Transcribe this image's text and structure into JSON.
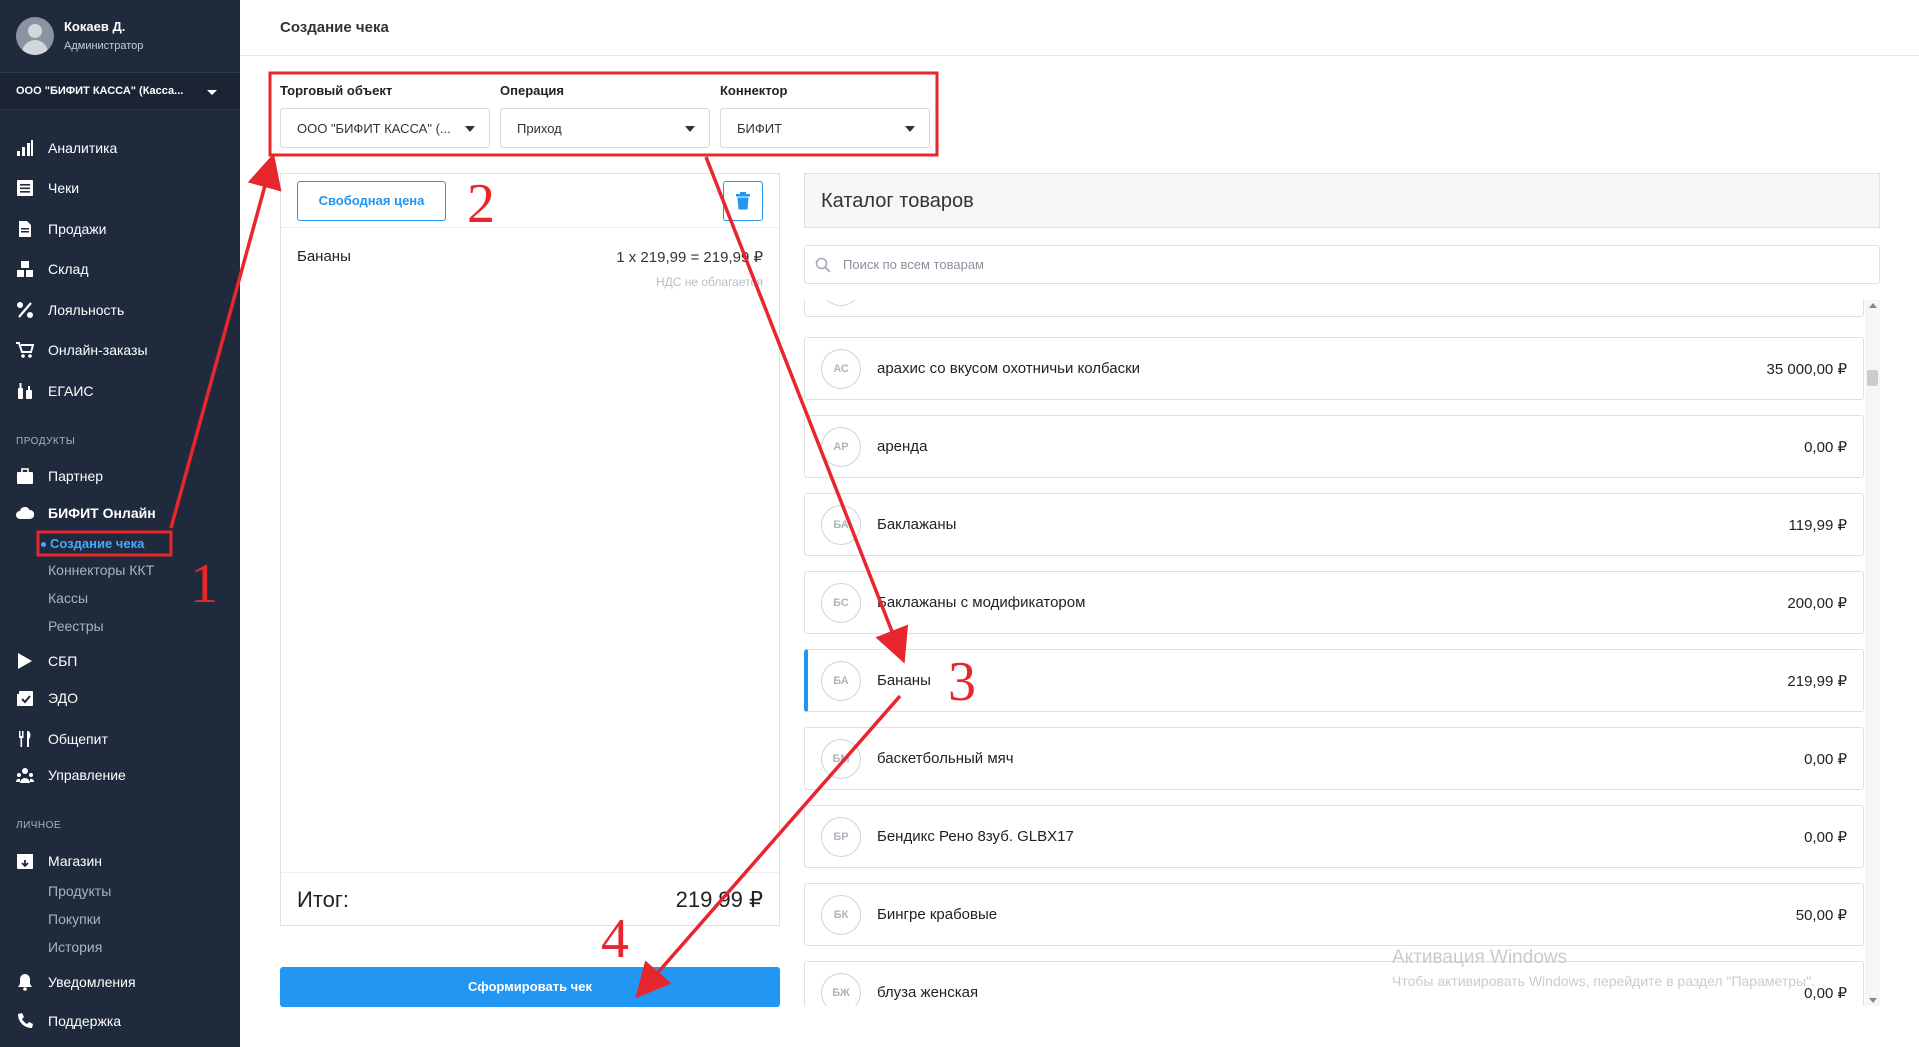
{
  "user": {
    "name": "Кокаев Д.",
    "role": "Администратор"
  },
  "org": {
    "label": "ООО \"БИФИТ КАССА\" (Касса..."
  },
  "nav": {
    "analytics": "Аналитика",
    "receipts": "Чеки",
    "sales": "Продажи",
    "warehouse": "Склад",
    "loyalty": "Лояльность",
    "online_orders": "Онлайн-заказы",
    "egais": "ЕГАИС",
    "products_section": "ПРОДУКТЫ",
    "partner": "Партнер",
    "bifit_online": "БИФИТ Онлайн",
    "create_receipt": "Создание чека",
    "kkt_connectors": "Коннекторы ККТ",
    "cash_registers": "Кассы",
    "registries": "Реестры",
    "sbp": "СБП",
    "edo": "ЭДО",
    "catering": "Общепит",
    "management": "Управление",
    "personal_section": "ЛИЧНОЕ",
    "shop": "Магазин",
    "shop_products": "Продукты",
    "purchases": "Покупки",
    "history": "История",
    "notifications": "Уведомления",
    "support": "Поддержка"
  },
  "page": {
    "title": "Создание чека"
  },
  "filters": {
    "trade_object_label": "Торговый объект",
    "trade_object_value": "ООО \"БИФИТ КАССА\" (...",
    "operation_label": "Операция",
    "operation_value": "Приход",
    "connector_label": "Коннектор",
    "connector_value": "БИФИТ"
  },
  "cart": {
    "free_price_label": "Свободная цена",
    "items": [
      {
        "name": "Бананы",
        "price_line": "1 x 219,99 = 219,99 ₽",
        "vat": "НДС не облагается"
      }
    ],
    "total_label": "Итог:",
    "total_value": "219,99 ₽",
    "submit_label": "Сформировать чек"
  },
  "catalog": {
    "title": "Каталог товаров",
    "search_placeholder": "Поиск по всем товарам",
    "items": [
      {
        "badge": "АС",
        "name": "арахис со вкусом охотничьи колбаски",
        "price": "35 000,00 ₽"
      },
      {
        "badge": "АР",
        "name": "аренда",
        "price": "0,00 ₽"
      },
      {
        "badge": "БА",
        "name": "Баклажаны",
        "price": "119,99 ₽"
      },
      {
        "badge": "БС",
        "name": "Баклажаны с модификатором",
        "price": "200,00 ₽"
      },
      {
        "badge": "БА",
        "name": "Бананы",
        "price": "219,99 ₽"
      },
      {
        "badge": "БМ",
        "name": "баскетбольный мяч",
        "price": "0,00 ₽"
      },
      {
        "badge": "БР",
        "name": "Бендикс Рено 8зуб. GLBX17",
        "price": "0,00 ₽"
      },
      {
        "badge": "БК",
        "name": "Бингре крабовые",
        "price": "50,00 ₽"
      },
      {
        "badge": "БЖ",
        "name": "блуза женская",
        "price": "0,00 ₽"
      }
    ]
  },
  "watermark": {
    "title": "Активация Windows",
    "text": "Чтобы активировать Windows, перейдите в раздел \"Параметры\"."
  },
  "annotations": {
    "step1": "1",
    "step2": "2",
    "step3": "3",
    "step4": "4"
  },
  "colors": {
    "accent": "#2196f3",
    "sidebar": "#1f2b3d",
    "annotation": "#e8262d"
  }
}
